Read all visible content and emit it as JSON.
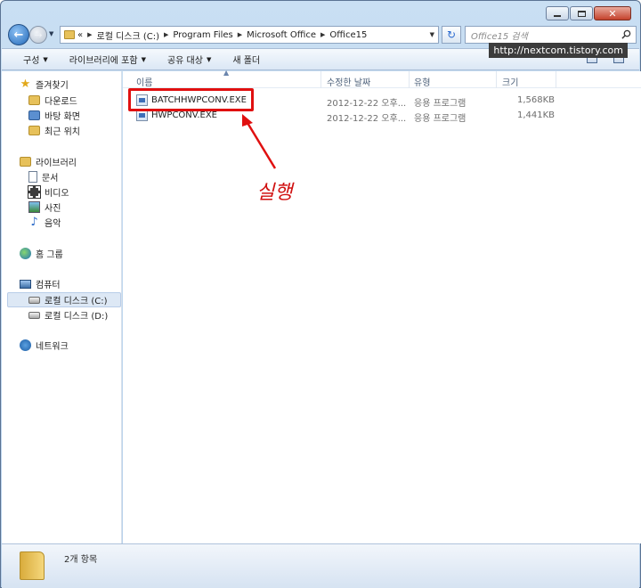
{
  "window": {
    "caption_buttons": [
      "minimize-icon",
      "maximize-icon",
      "close-icon"
    ]
  },
  "address_bar": {
    "prefix": "«",
    "crumbs": [
      "로컬 디스크 (C:)",
      "Program Files",
      "Microsoft Office",
      "Office15"
    ]
  },
  "search": {
    "placeholder": "Office15 검색"
  },
  "watermark": "http://nextcom.tistory.com",
  "toolbar": {
    "organize": "구성",
    "include_library": "라이브러리에 포함",
    "share_with": "공유 대상",
    "new_folder": "새 폴더"
  },
  "nav": {
    "favorites": {
      "label": "즐겨찾기",
      "items": [
        "다운로드",
        "바탕 화면",
        "최근 위치"
      ]
    },
    "libraries": {
      "label": "라이브러리",
      "items": [
        "문서",
        "비디오",
        "사진",
        "음악"
      ]
    },
    "homegroup": "홈 그룹",
    "computer": {
      "label": "컴퓨터",
      "items": [
        "로컬 디스크 (C:)",
        "로컬 디스크 (D:)"
      ]
    },
    "network": "네트워크"
  },
  "columns": {
    "name": "이름",
    "date": "수정한 날짜",
    "type": "유형",
    "size": "크기"
  },
  "files": [
    {
      "name": "BATCHHWPCONV.EXE",
      "date": "2012-12-22 오후...",
      "type": "응용 프로그램",
      "size": "1,568KB",
      "icon": "exe-icon"
    },
    {
      "name": "HWPCONV.EXE",
      "date": "2012-12-22 오후...",
      "type": "응용 프로그램",
      "size": "1,441KB",
      "icon": "exe-icon"
    }
  ],
  "annotation": {
    "text": "실행",
    "color": "#e01010"
  },
  "status": {
    "count": "2개 항목"
  }
}
